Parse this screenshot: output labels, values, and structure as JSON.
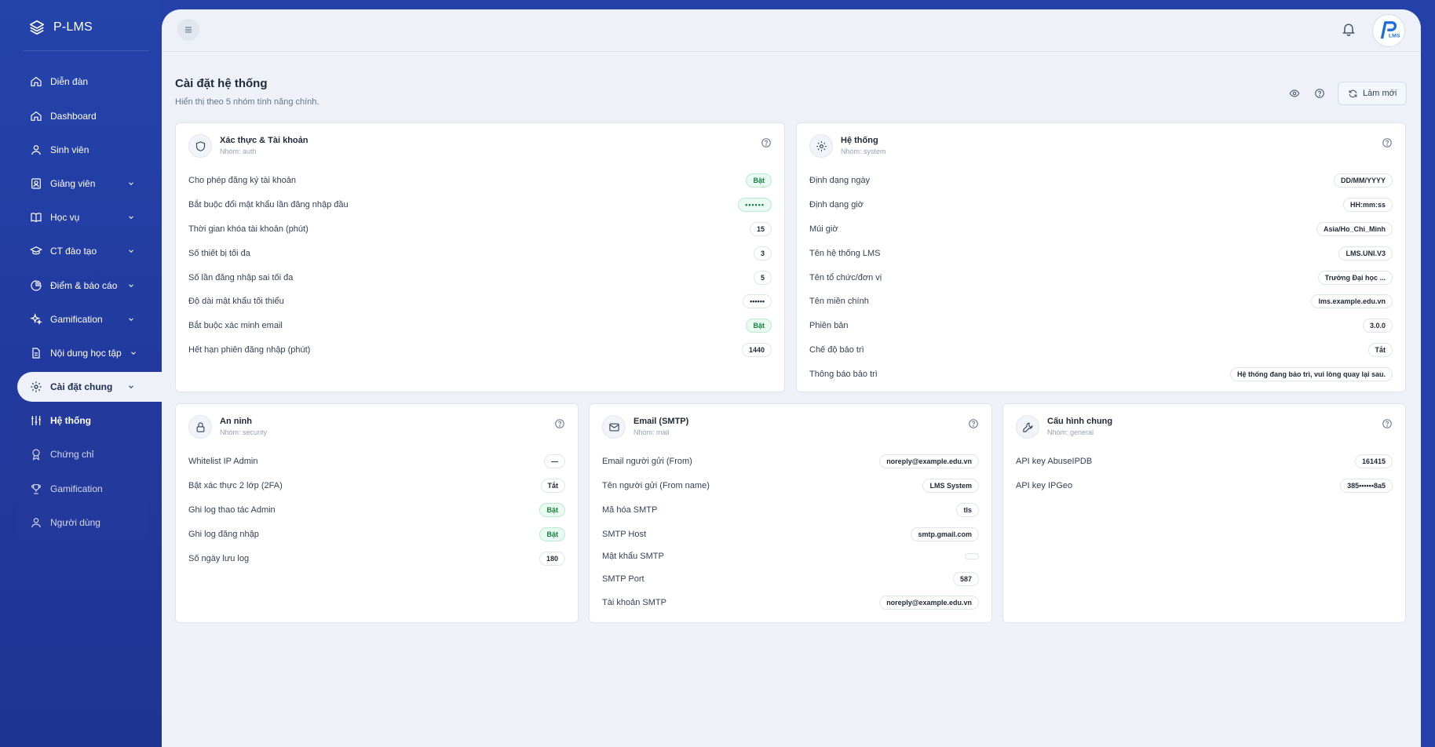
{
  "brand": {
    "name": "P-LMS"
  },
  "sidebar": {
    "items": [
      {
        "label": "Diễn đàn",
        "icon": "home-icon"
      },
      {
        "label": "Dashboard",
        "icon": "home-icon"
      },
      {
        "label": "Sinh viên",
        "icon": "user-icon"
      },
      {
        "label": "Giảng viên",
        "icon": "user-card-icon"
      },
      {
        "label": "Học vụ",
        "icon": "book-icon"
      },
      {
        "label": "CT đào tạo",
        "icon": "graduation-cap-icon"
      },
      {
        "label": "Điểm & báo cáo",
        "icon": "pie-chart-icon"
      },
      {
        "label": "Gamification",
        "icon": "sparkle-icon"
      },
      {
        "label": "Nội dung học tập",
        "icon": "file-icon"
      },
      {
        "label": "Cài đặt chung",
        "icon": "gear-icon"
      }
    ],
    "sub_items": [
      {
        "label": "Hệ thống",
        "icon": "sliders-icon"
      },
      {
        "label": "Chứng chỉ",
        "icon": "award-icon"
      },
      {
        "label": "Gamification",
        "icon": "trophy-icon"
      },
      {
        "label": "Người dùng",
        "icon": "users-icon"
      }
    ]
  },
  "header": {
    "avatar_text": "LMS"
  },
  "page": {
    "title": "Cài đặt hệ thống",
    "subtitle": "Hiển thị theo 5 nhóm tính năng chính.",
    "refresh_label": "Làm mới"
  },
  "cards": {
    "auth": {
      "title": "Xác thực & Tài khoản",
      "group": "Nhóm: auth",
      "rows": [
        {
          "label": "Cho phép đăng ký tài khoản",
          "value": "Bật"
        },
        {
          "label": "Bắt buộc đổi mật khẩu lần đăng nhập đầu",
          "value": "••••••"
        },
        {
          "label": "Thời gian khóa tài khoản (phút)",
          "value": "15"
        },
        {
          "label": "Số thiết bị tối đa",
          "value": "3"
        },
        {
          "label": "Số lần đăng nhập sai tối đa",
          "value": "5"
        },
        {
          "label": "Độ dài mật khẩu tối thiểu",
          "value": "••••••"
        },
        {
          "label": "Bắt buộc xác minh email",
          "value": "Bật"
        },
        {
          "label": "Hết hạn phiên đăng nhập (phút)",
          "value": "1440"
        }
      ]
    },
    "system": {
      "title": "Hệ thống",
      "group": "Nhóm: system",
      "rows": [
        {
          "label": "Định dạng ngày",
          "value": "DD/MM/YYYY"
        },
        {
          "label": "Định dạng giờ",
          "value": "HH:mm:ss"
        },
        {
          "label": "Múi giờ",
          "value": "Asia/Ho_Chi_Minh"
        },
        {
          "label": "Tên hệ thống LMS",
          "value": "LMS.UNI.V3"
        },
        {
          "label": "Tên tổ chức/đơn vị",
          "value": "Trường Đại học ..."
        },
        {
          "label": "Tên miền chính",
          "value": "lms.example.edu.vn"
        },
        {
          "label": "Phiên bản",
          "value": "3.0.0"
        },
        {
          "label": "Chế độ bảo trì",
          "value": "Tắt"
        },
        {
          "label": "Thông báo bảo trì",
          "value": "Hệ thống đang bảo trì, vui lòng quay lại sau."
        }
      ]
    },
    "security": {
      "title": "An ninh",
      "group": "Nhóm: security",
      "rows": [
        {
          "label": "Whitelist IP Admin",
          "value": "—"
        },
        {
          "label": "Bật xác thực 2 lớp (2FA)",
          "value": "Tắt"
        },
        {
          "label": "Ghi log thao tác Admin",
          "value": "Bật"
        },
        {
          "label": "Ghi log đăng nhập",
          "value": "Bật"
        },
        {
          "label": "Số ngày lưu log",
          "value": "180"
        }
      ]
    },
    "mail": {
      "title": "Email (SMTP)",
      "group": "Nhóm: mail",
      "rows": [
        {
          "label": "Email người gửi (From)",
          "value": "noreply@example.edu.vn"
        },
        {
          "label": "Tên người gửi (From name)",
          "value": "LMS System"
        },
        {
          "label": "Mã hóa SMTP",
          "value": "tls"
        },
        {
          "label": "SMTP Host",
          "value": "smtp.gmail.com"
        },
        {
          "label": "Mật khẩu SMTP",
          "value": ""
        },
        {
          "label": "SMTP Port",
          "value": "587"
        },
        {
          "label": "Tài khoản SMTP",
          "value": "noreply@example.edu.vn"
        }
      ]
    },
    "general": {
      "title": "Cấu hình chung",
      "group": "Nhóm: general",
      "rows": [
        {
          "label": "API key AbuseIPDB",
          "value": "161415"
        },
        {
          "label": "API key IPGeo",
          "value": "385••••••8a5"
        }
      ]
    }
  },
  "colors": {
    "sidebar_bg": "#2341a8",
    "main_bg": "#eef2f8",
    "on_badge_bg": "#eafaf2",
    "on_badge_text": "#15803d"
  }
}
